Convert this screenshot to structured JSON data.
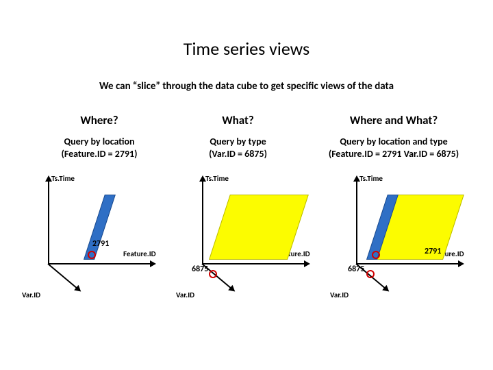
{
  "title": "Time series views",
  "subtitle": "We can “slice” through the data cube to get specific views of the data",
  "columns": {
    "where": {
      "question": "Where?",
      "query_line1": "Query by location",
      "query_line2": "(Feature.ID = 2791)"
    },
    "what": {
      "question": "What?",
      "query_line1": "Query by type",
      "query_line2": "(Var.ID = 6875)"
    },
    "both": {
      "question": "Where and What?",
      "query_line1": "Query by location and type",
      "query_line2": "(Feature.ID = 2791 Var.ID = 6875)"
    }
  },
  "axes": {
    "y": "Ts.Time",
    "x": "Feature.ID",
    "z": "Var.ID"
  },
  "values": {
    "feature_id": "2791",
    "var_id": "6875"
  }
}
